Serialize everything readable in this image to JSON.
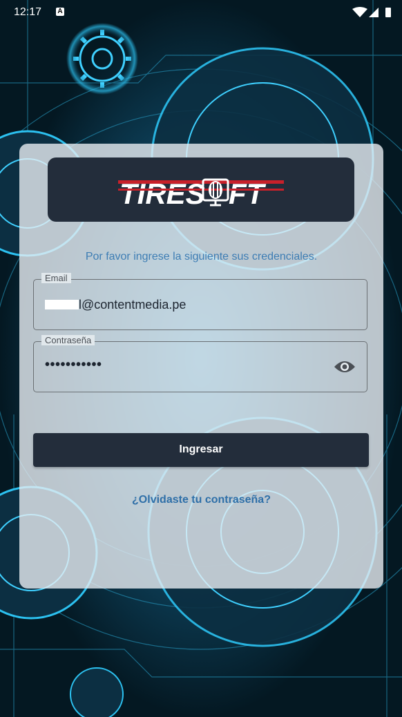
{
  "status_bar": {
    "time": "12:17",
    "badge": "A"
  },
  "logo": {
    "text": "TIRESOFT",
    "brand_red": "#c8202a",
    "brand_white": "#ffffff"
  },
  "login": {
    "prompt": "Por favor ingrese la siguiente sus credenciales.",
    "email": {
      "label": "Email",
      "value": "l@contentmedia.pe"
    },
    "password": {
      "label": "Contraseña",
      "value": "•••••••••••"
    },
    "submit_label": "Ingresar",
    "forgot_label": "¿Olvidaste tu contraseña?"
  },
  "colors": {
    "dark_navy": "#232d3b",
    "link_blue": "#2e6fa8",
    "background": "#06202c"
  }
}
